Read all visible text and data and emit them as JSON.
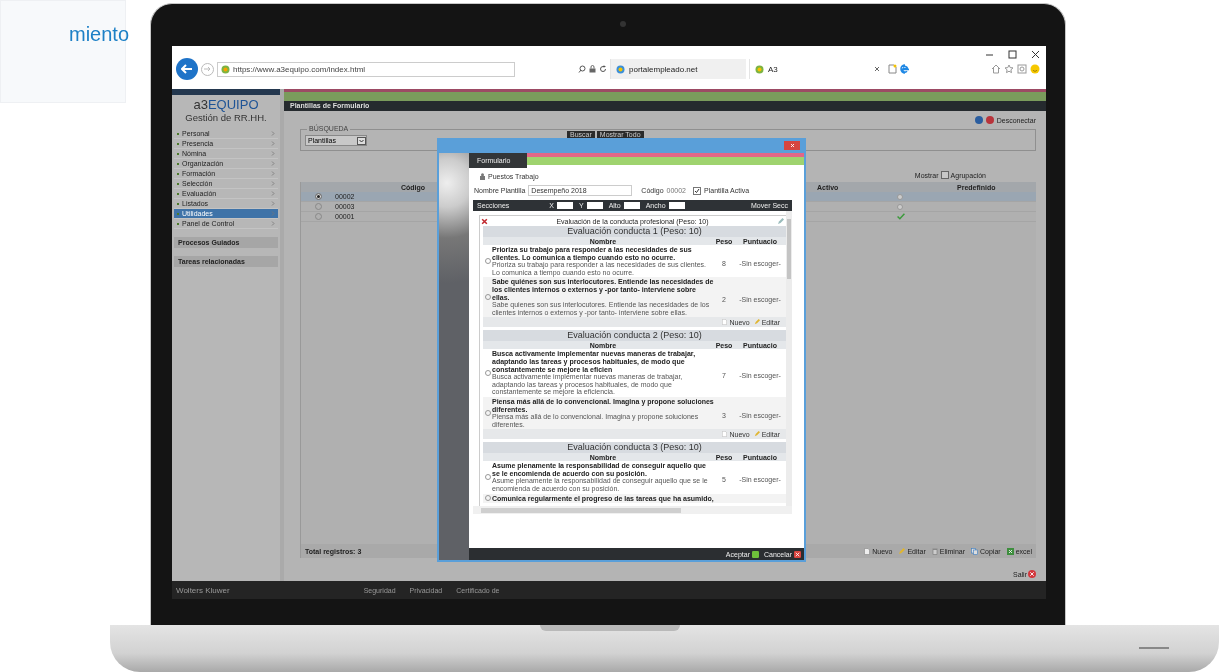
{
  "caption": "miento",
  "browser": {
    "address": "https://www.a3equipo.com/index.html",
    "tabs": [
      {
        "label": "portalempleado.net",
        "selected": false
      },
      {
        "label": "A3",
        "selected": true
      }
    ]
  },
  "sidebar": {
    "logo_prefix": "a3",
    "logo_name": "EQUIPO",
    "subtitle": "Gestión de RR.HH.",
    "items": [
      {
        "label": "Personal",
        "selected": false
      },
      {
        "label": "Presencia",
        "selected": false
      },
      {
        "label": "Nómina",
        "selected": false
      },
      {
        "label": "Organización",
        "selected": false
      },
      {
        "label": "Formación",
        "selected": false
      },
      {
        "label": "Selección",
        "selected": false
      },
      {
        "label": "Evaluación",
        "selected": false
      },
      {
        "label": "Listados",
        "selected": false
      },
      {
        "label": "Utilidades",
        "selected": true
      },
      {
        "label": "Panel de Control",
        "selected": false
      }
    ],
    "panels": [
      "Procesos Guiados",
      "Tareas relacionadas"
    ]
  },
  "main": {
    "title": "Plantillas de Formulario",
    "logout": "Desconectar",
    "search_legend": "BÚSQUEDA",
    "search_select": "Plantillas",
    "search_buttons": [
      "Buscar",
      "Mostrar Todo"
    ],
    "grouping": {
      "before": "Mostrar",
      "after": "Agrupación",
      "checked": false
    },
    "columns": [
      "Código",
      "Activo",
      "Predefinido"
    ],
    "rows": [
      {
        "code": "00002",
        "selected": true,
        "predefined": false
      },
      {
        "code": "00003",
        "selected": false,
        "predefined": false
      },
      {
        "code": "00001",
        "selected": false,
        "predefined": true
      }
    ],
    "total": "Total registros: 3",
    "actions": [
      {
        "kind": "new",
        "label": "Nuevo"
      },
      {
        "kind": "edit",
        "label": "Editar"
      },
      {
        "kind": "delete",
        "label": "Eliminar"
      },
      {
        "kind": "copy",
        "label": "Copiar"
      },
      {
        "kind": "excel",
        "label": "excel"
      }
    ],
    "exit": "Salir"
  },
  "footer": {
    "brand": "Wolters Kluwer",
    "links": [
      "Seguridad",
      "Privacidad",
      "Certificado de"
    ]
  },
  "modal": {
    "tab": "Formulario",
    "section": "Puestos Trabajo",
    "name_label": "Nombre Plantilla",
    "name_value": "Desempeño 2018",
    "code_label": "Código",
    "code_value": "00002",
    "active_label": "Plantilla Activa",
    "active_checked": true,
    "sections_title": "Secciones",
    "coord_labels": [
      "X",
      "Y",
      "Alto",
      "Ancho"
    ],
    "move": "Mover Secc",
    "panel_title": "Evaluación de la conducta profesional (Peso: 10)",
    "groups": [
      {
        "title": "Evaluación conducta 1 (Peso: 10)",
        "columns": [
          "Nombre",
          "Peso",
          "Puntuacio"
        ],
        "footer": [
          "Nuevo",
          "Editar"
        ],
        "items": [
          {
            "selected": false,
            "title": "Prioriza su trabajo para responder a las necesidades de sus clientes. Lo comunica a tiempo cuando esto no ocurre.",
            "description": "Prioriza su trabajo para responder a las necesidades de sus clientes. Lo comunica a tiempo cuando esto no ocurre.",
            "weight": "8",
            "score": "-Sin escoger-"
          },
          {
            "selected": false,
            "title": "Sabe quiénes son sus interlocutores. Entiende las necesidades de los clientes internos o externos y -por tanto- interviene sobre ellas.",
            "description": "Sabe quienes son sus interlocutores. Entiende las necesidades de los clientes internos o externos y -por tanto- interviene sobre ellas.",
            "weight": "2",
            "score": "-Sin escoger-"
          }
        ]
      },
      {
        "title": "Evaluación conducta 2 (Peso: 10)",
        "columns": [
          "Nombre",
          "Peso",
          "Puntuacio"
        ],
        "footer": [
          "Nuevo",
          "Editar"
        ],
        "items": [
          {
            "selected": false,
            "title": "Busca activamente implementar nuevas maneras de trabajar, adaptando las tareas y procesos habituales, de modo que constantemente se mejore la eficien",
            "description": "Busca activamente implementar nuevas maneras de trabajar, adaptando las tareas y procesos habituales, de modo que constantemente se mejore la eficiencia.",
            "weight": "7",
            "score": "-Sin escoger-"
          },
          {
            "selected": false,
            "title": "Piensa más allá de lo convencional. Imagina y propone soluciones diferentes.",
            "description": "Piensa más allá de lo convencional. Imagina y propone soluciones diferentes.",
            "weight": "3",
            "score": "-Sin escoger-"
          }
        ]
      },
      {
        "title": "Evaluación conducta 3 (Peso: 10)",
        "columns": [
          "Nombre",
          "Peso",
          "Puntuacio"
        ],
        "items": [
          {
            "selected": false,
            "title": "Asume plenamente la responsabilidad de conseguir aquello que se le encomienda de acuerdo con su posición.",
            "description": "Asume plenamente la responsabilidad de conseguir aquello que se le encomienda de acuerdo con su posición.",
            "weight": "5",
            "score": "-Sin escoger-"
          },
          {
            "selected": false,
            "title": "Comunica regularmente el progreso de las tareas que ha asumido,"
          }
        ]
      }
    ],
    "buttons": [
      {
        "kind": "accept",
        "label": "Aceptar"
      },
      {
        "kind": "cancel",
        "label": "Cancelar"
      }
    ]
  }
}
